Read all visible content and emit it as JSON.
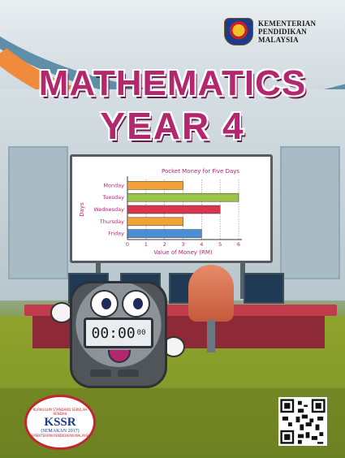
{
  "logo": {
    "line1": "KEMENTERIAN",
    "line2": "PENDIDIKAN",
    "line3": "MALAYSIA"
  },
  "title": {
    "line1": "MATHEMATICS",
    "line2": "YEAR 4"
  },
  "chart_data": {
    "type": "bar",
    "orientation": "horizontal",
    "title": "Pocket Money for Five Days",
    "xlabel": "Value of Money (RM)",
    "ylabel": "Days",
    "categories": [
      "Monday",
      "Tuesday",
      "Wednesday",
      "Thursday",
      "Friday"
    ],
    "values": [
      3,
      6,
      5,
      3,
      4
    ],
    "colors": [
      "#f2a234",
      "#9cc548",
      "#d8354f",
      "#f2a234",
      "#4a8fd6"
    ],
    "xticks": [
      "0",
      "1",
      "2",
      "3",
      "4",
      "5",
      "6"
    ],
    "xlim": [
      0,
      6
    ],
    "grid": "dotted-vertical"
  },
  "mascot": {
    "clock_main": "00:00",
    "clock_small": "00"
  },
  "badge": {
    "ring": "KURIKULUM STANDARD SEKOLAH RENDAH",
    "main": "KSSR",
    "sub": "(SEMAKAN 2017)",
    "bottom": "KEMENTERIAN PENDIDIKAN MALAYSIA"
  }
}
